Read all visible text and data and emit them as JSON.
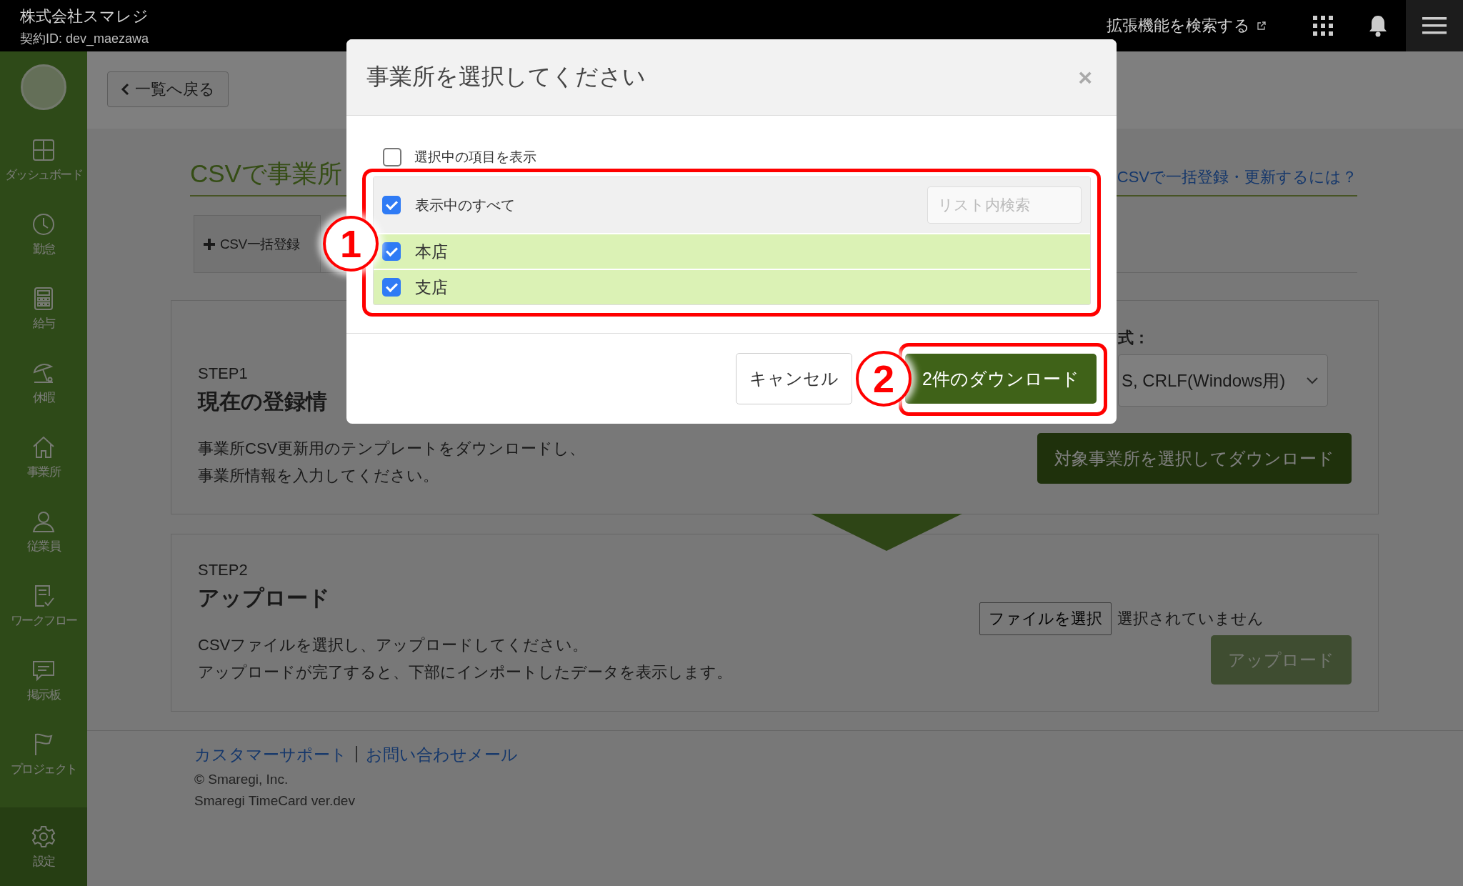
{
  "topbar": {
    "company": "株式会社スマレジ",
    "contract_id": "契約ID: dev_maezawa",
    "extension_search": "拡張機能を検索する"
  },
  "sidebar": {
    "items": [
      {
        "label": "ダッシュボード"
      },
      {
        "label": "勤怠"
      },
      {
        "label": "給与"
      },
      {
        "label": "休暇"
      },
      {
        "label": "事業所"
      },
      {
        "label": "従業員"
      },
      {
        "label": "ワークフロー"
      },
      {
        "label": "掲示板"
      },
      {
        "label": "プロジェクト"
      }
    ],
    "settings": "設定"
  },
  "back_button": "一覧へ戻る",
  "page": {
    "title": "CSVで事業所",
    "help_link": "CSVで一括登録・更新するには？",
    "tab_button": "CSV一括登録"
  },
  "steps": [
    {
      "kind": "download",
      "step": "STEP1",
      "title": "現在の登録情",
      "description": [
        "事業所CSV更新用のテンプレートをダウンロードし、",
        "事業所情報を入力してください。"
      ],
      "format_label": "式：",
      "format_value": "S, CRLF(Windows用)",
      "button": "対象事業所を選択してダウンロード"
    },
    {
      "kind": "upload",
      "step": "STEP2",
      "title": "アップロード",
      "description": [
        "CSVファイルを選択し、アップロードしてください。",
        "アップロードが完了すると、下部にインポートしたデータを表示します。"
      ],
      "file_button": "ファイルを選択",
      "file_status": "選択されていません",
      "upload_button": {
        "label": "アップロード",
        "disabled": true
      }
    }
  ],
  "footer": {
    "links": [
      "カスタマーサポート",
      "お問い合わせメール"
    ],
    "separator": "|",
    "copyright": "© Smaregi, Inc.",
    "version": "Smaregi TimeCard ver.dev"
  },
  "modal": {
    "title": "事業所を選択してください",
    "close": "×",
    "show_selected": {
      "label": "選択中の項目を表示",
      "checked": false
    },
    "select_all": {
      "label": "表示中のすべて",
      "checked": true
    },
    "search": {
      "placeholder": "リスト内検索"
    },
    "items": [
      {
        "label": "本店",
        "checked": true
      },
      {
        "label": "支店",
        "checked": true
      }
    ],
    "cancel_button": "キャンセル",
    "download_button": "2件のダウンロード"
  },
  "annotations": [
    {
      "label": "1"
    },
    {
      "label": "2"
    }
  ]
}
